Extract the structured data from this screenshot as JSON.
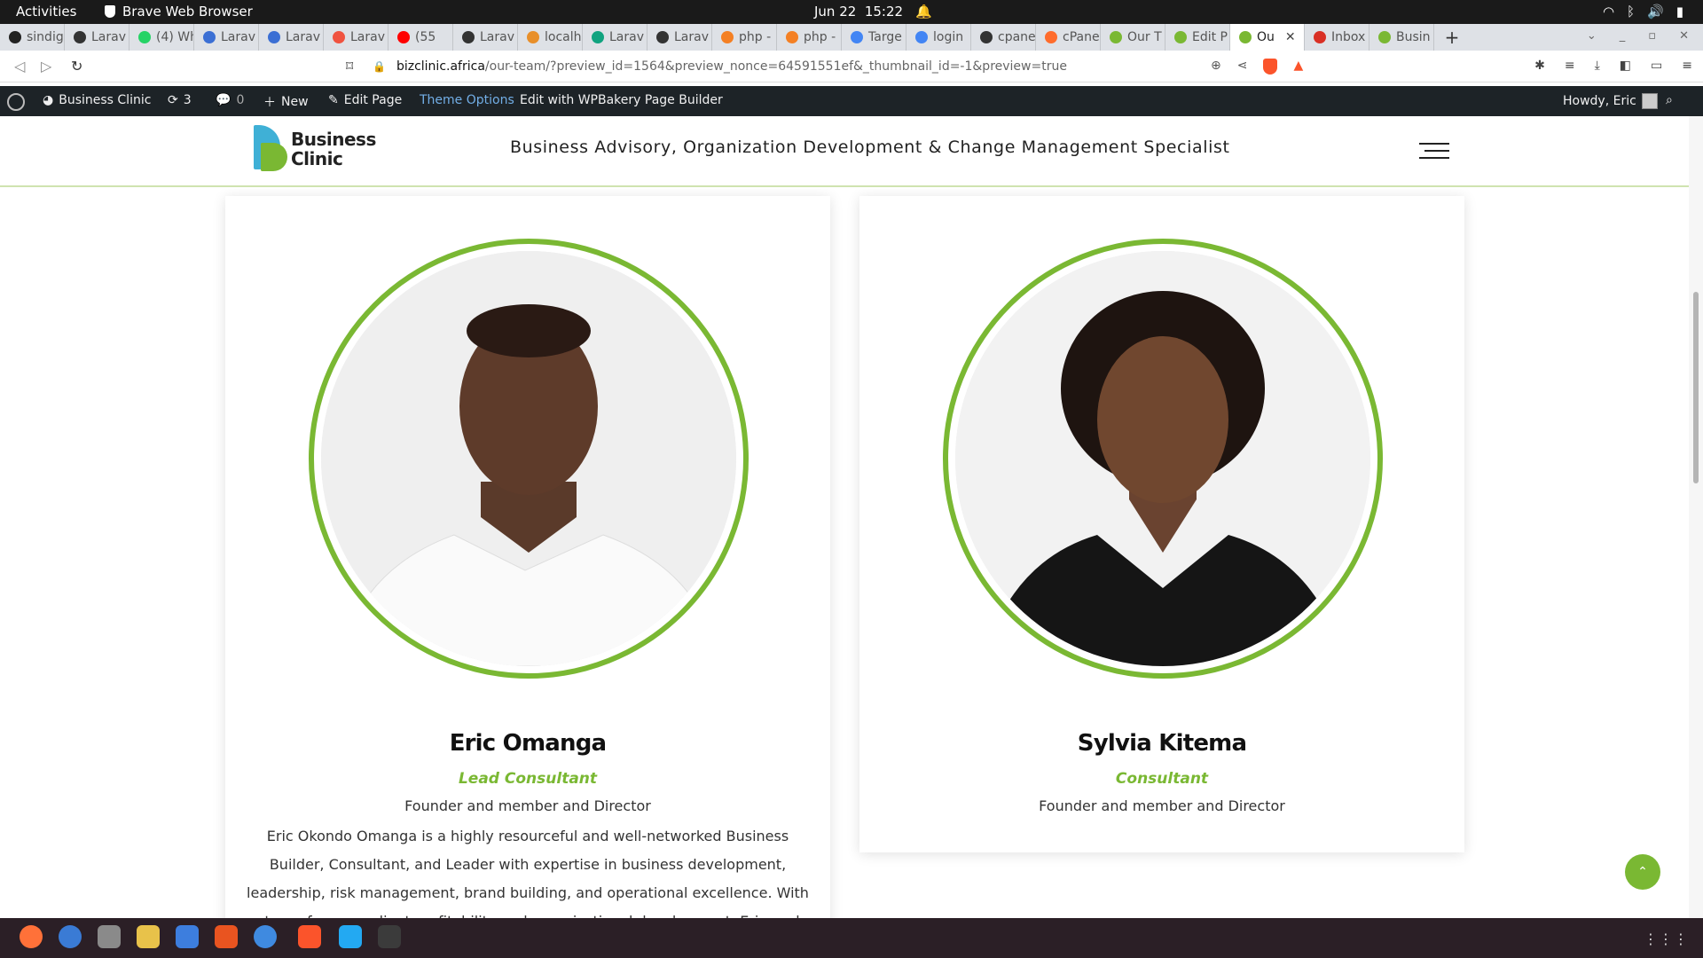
{
  "system": {
    "activities": "Activities",
    "app_name": "Brave Web Browser",
    "date": "Jun 22",
    "time": "15:22"
  },
  "tabs": [
    {
      "label": "sindig",
      "color": "#222222"
    },
    {
      "label": "Larav",
      "color": "#333333"
    },
    {
      "label": "(4) Wh",
      "color": "#25d366"
    },
    {
      "label": "Larav",
      "color": "#3b6fd4"
    },
    {
      "label": "Larav",
      "color": "#3b6fd4"
    },
    {
      "label": "Larav",
      "color": "#f05340"
    },
    {
      "label": "(55",
      "color": "#ff0000"
    },
    {
      "label": "Larav",
      "color": "#333333"
    },
    {
      "label": "localh",
      "color": "#e88f2a"
    },
    {
      "label": "Larav",
      "color": "#10a37f"
    },
    {
      "label": "Larav",
      "color": "#333333"
    },
    {
      "label": "php -",
      "color": "#f48024"
    },
    {
      "label": "php -",
      "color": "#f48024"
    },
    {
      "label": "Targe",
      "color": "#4285f4"
    },
    {
      "label": "login",
      "color": "#4285f4"
    },
    {
      "label": "cpane",
      "color": "#333333"
    },
    {
      "label": "cPane",
      "color": "#ff6c2c"
    },
    {
      "label": "Our T",
      "color": "#7ab833"
    },
    {
      "label": "Edit P",
      "color": "#7ab833"
    },
    {
      "label": "Ou",
      "color": "#7ab833",
      "active": true
    },
    {
      "label": "Inbox",
      "color": "#d93025"
    },
    {
      "label": "Busin",
      "color": "#7ab833"
    }
  ],
  "address_bar": {
    "host": "bizclinic.africa",
    "path": "/our-team/?preview_id=1564&preview_nonce=64591551ef&_thumbnail_id=-1&preview=true"
  },
  "wp_admin": {
    "site_name": "Business Clinic",
    "updates": "3",
    "comments": "0",
    "new": "New",
    "edit_page": "Edit Page",
    "theme_options": "Theme Options",
    "wpbakery": "Edit with WPBakery Page Builder",
    "howdy": "Howdy, Eric"
  },
  "site": {
    "logo_line1": "Business",
    "logo_line2": "Clinic",
    "tagline": "Business Advisory, Organization Development & Change Management Specialist"
  },
  "team": [
    {
      "name": "Eric Omanga",
      "role": "Lead Consultant",
      "subtitle": "Founder and member and Director",
      "bio": "Eric Okondo Omanga is a highly resourceful and well-networked Business Builder, Consultant, and Leader with expertise in business development, leadership, risk management, brand building, and operational excellence. With a strong focus on client profitability and organizational development, Eric seeks opportunities to"
    },
    {
      "name": "Sylvia Kitema",
      "role": "Consultant",
      "subtitle": "Founder and member and Director"
    }
  ],
  "colors": {
    "brand_green": "#7ab833",
    "brand_blue": "#3fb0d6",
    "wp_bar": "#1d2327"
  }
}
